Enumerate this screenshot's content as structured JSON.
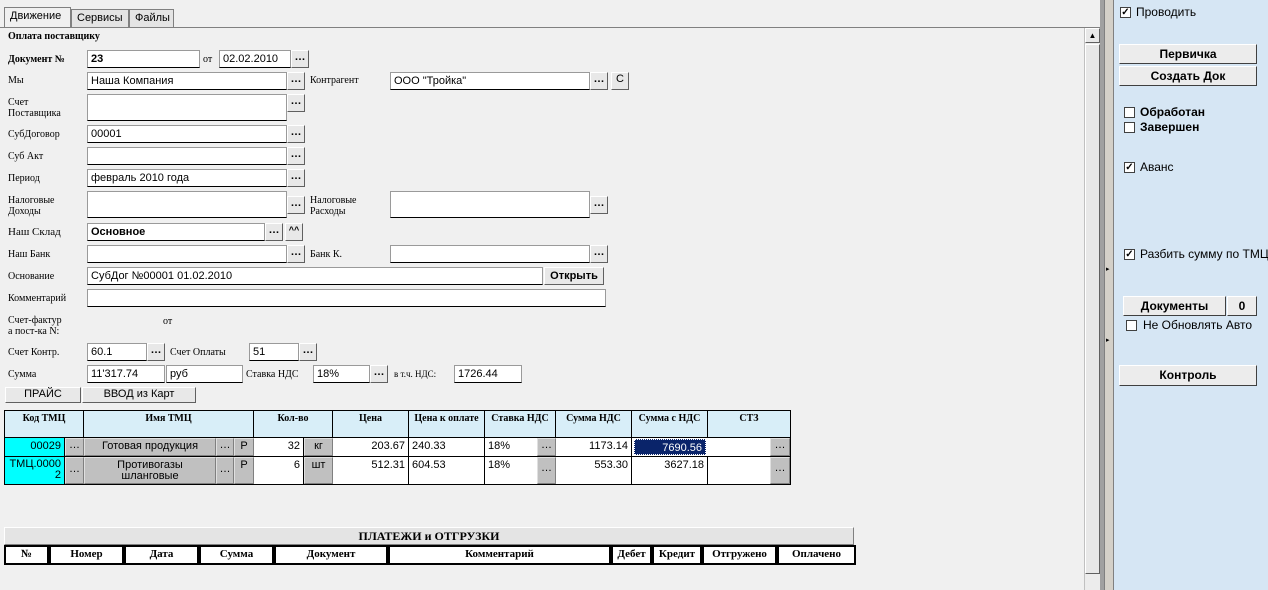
{
  "tabs": [
    "Движение",
    "Сервисы",
    "Файлы"
  ],
  "form_title": "Оплата поставщику",
  "doc": {
    "number_label": "Документ №",
    "number": "23",
    "date_label": "от",
    "date": "02.02.2010",
    "we_label": "Мы",
    "we": "Наша Компания",
    "contragent_label": "Контрагент",
    "contragent": "ООО \"Тройка\"",
    "contragent_btn": "С",
    "invoice_label_1": "Счет",
    "invoice_label_2": "Поставщика",
    "invoice": "",
    "subcontract_label": "СубДоговор",
    "subcontract": "00001",
    "subact_label": "Суб Акт",
    "subact": "",
    "period_label": "Период",
    "period": "февраль 2010 года",
    "tax_income_label_1": "Налоговые",
    "tax_income_label_2": "Доходы",
    "tax_income": "",
    "tax_expense_label_1": "Налоговые",
    "tax_expense_label_2": "Расходы",
    "tax_expense": "",
    "warehouse_label": "Наш Склад",
    "warehouse": "Основное",
    "warehouse_btn": "^^",
    "our_bank_label": "Наш Банк",
    "our_bank": "",
    "bank_k_label": "Банк К.",
    "bank_k": "",
    "basis_label": "Основание",
    "basis": "СубДог №00001 01.02.2010",
    "open_btn": "Открыть",
    "comment_label": "Комментарий",
    "comment": "",
    "sf_label_1": "Счет-фактур",
    "sf_label_2": "а пост-ка N:",
    "sf_from": "от",
    "acct_contr_label": "Счет Контр.",
    "acct_contr": "60.1",
    "acct_pay_label": "Счет Оплаты",
    "acct_pay": "51",
    "sum_label": "Сумма",
    "sum": "11'317.74",
    "currency": "руб",
    "vat_rate_label": "Ставка НДС",
    "vat_rate": "18%",
    "vat_incl_label": "в т.ч. НДС:",
    "vat_incl": "1726.44",
    "price_btn": "ПРАЙС",
    "cards_btn": "ВВОД из Карт"
  },
  "grid": {
    "headers": [
      "Код ТМЦ",
      "Имя ТМЦ",
      "Кол-во",
      "Цена",
      "Цена к оплате",
      "Ставка НДС",
      "Сумма НДС",
      "Сумма с НДС",
      "СТЗ"
    ],
    "rows": [
      {
        "code": "00029",
        "name": "Готовая продукция",
        "p": "Р",
        "qty": "32",
        "unit": "кг",
        "price": "203.67",
        "pay_price": "240.33",
        "vat": "18%",
        "vat_sum": "1173.14",
        "total": "7690.56",
        "stz": ""
      },
      {
        "code_1": "ТМЦ.0000",
        "code_2": "2",
        "name_1": "Противогазы",
        "name_2": "шланговые",
        "p": "Р",
        "qty": "6",
        "unit": "шт",
        "price": "512.31",
        "pay_price": "604.53",
        "vat": "18%",
        "vat_sum": "553.30",
        "total": "3627.18",
        "stz": ""
      }
    ]
  },
  "payments": {
    "title": "ПЛАТЕЖИ и ОТГРУЗКИ",
    "headers": [
      "№",
      "Номер",
      "Дата",
      "Сумма",
      "Документ",
      "Комментарий",
      "Дебет",
      "Кредит",
      "Отгружено",
      "Оплачено"
    ]
  },
  "right_panel": {
    "post_label": "Проводить",
    "post_checked": true,
    "primary_btn": "Первичка",
    "create_btn": "Создать Док",
    "processed_label": "Обработан",
    "processed_checked": false,
    "completed_label": "Завершен",
    "completed_checked": false,
    "advance_label": "Аванс",
    "advance_checked": true,
    "split_label": "Разбить сумму по ТМЦ",
    "split_checked": true,
    "docs_btn": "Документы",
    "docs_count": "0",
    "no_update_label": "Не Обновлять Авто",
    "no_update_checked": false,
    "control_btn": "Контроль"
  },
  "colors": {
    "right_panel_bg": "#d6e6f4",
    "code_cell_bg": "#00ffff",
    "header_bg": "#d8eef8",
    "selected_bg": "#0a246a"
  }
}
